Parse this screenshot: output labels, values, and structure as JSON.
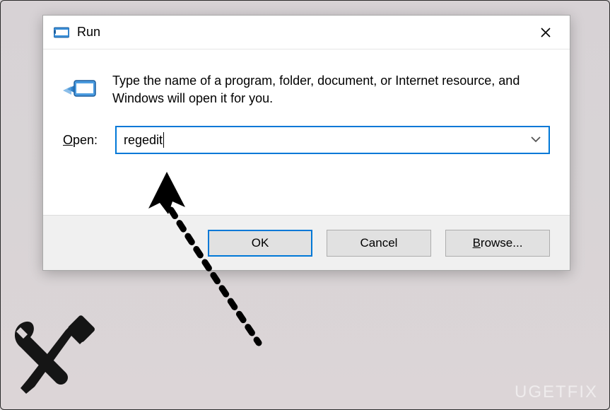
{
  "dialog": {
    "title": "Run",
    "instruction": "Type the name of a program, folder, document, or Internet resource, and Windows will open it for you.",
    "open_label_pre": "O",
    "open_label_post": "pen:",
    "input_value": "regedit",
    "buttons": {
      "ok": "OK",
      "cancel": "Cancel",
      "browse_pre": "B",
      "browse_post": "rowse..."
    }
  },
  "watermark": "UGETFIX"
}
